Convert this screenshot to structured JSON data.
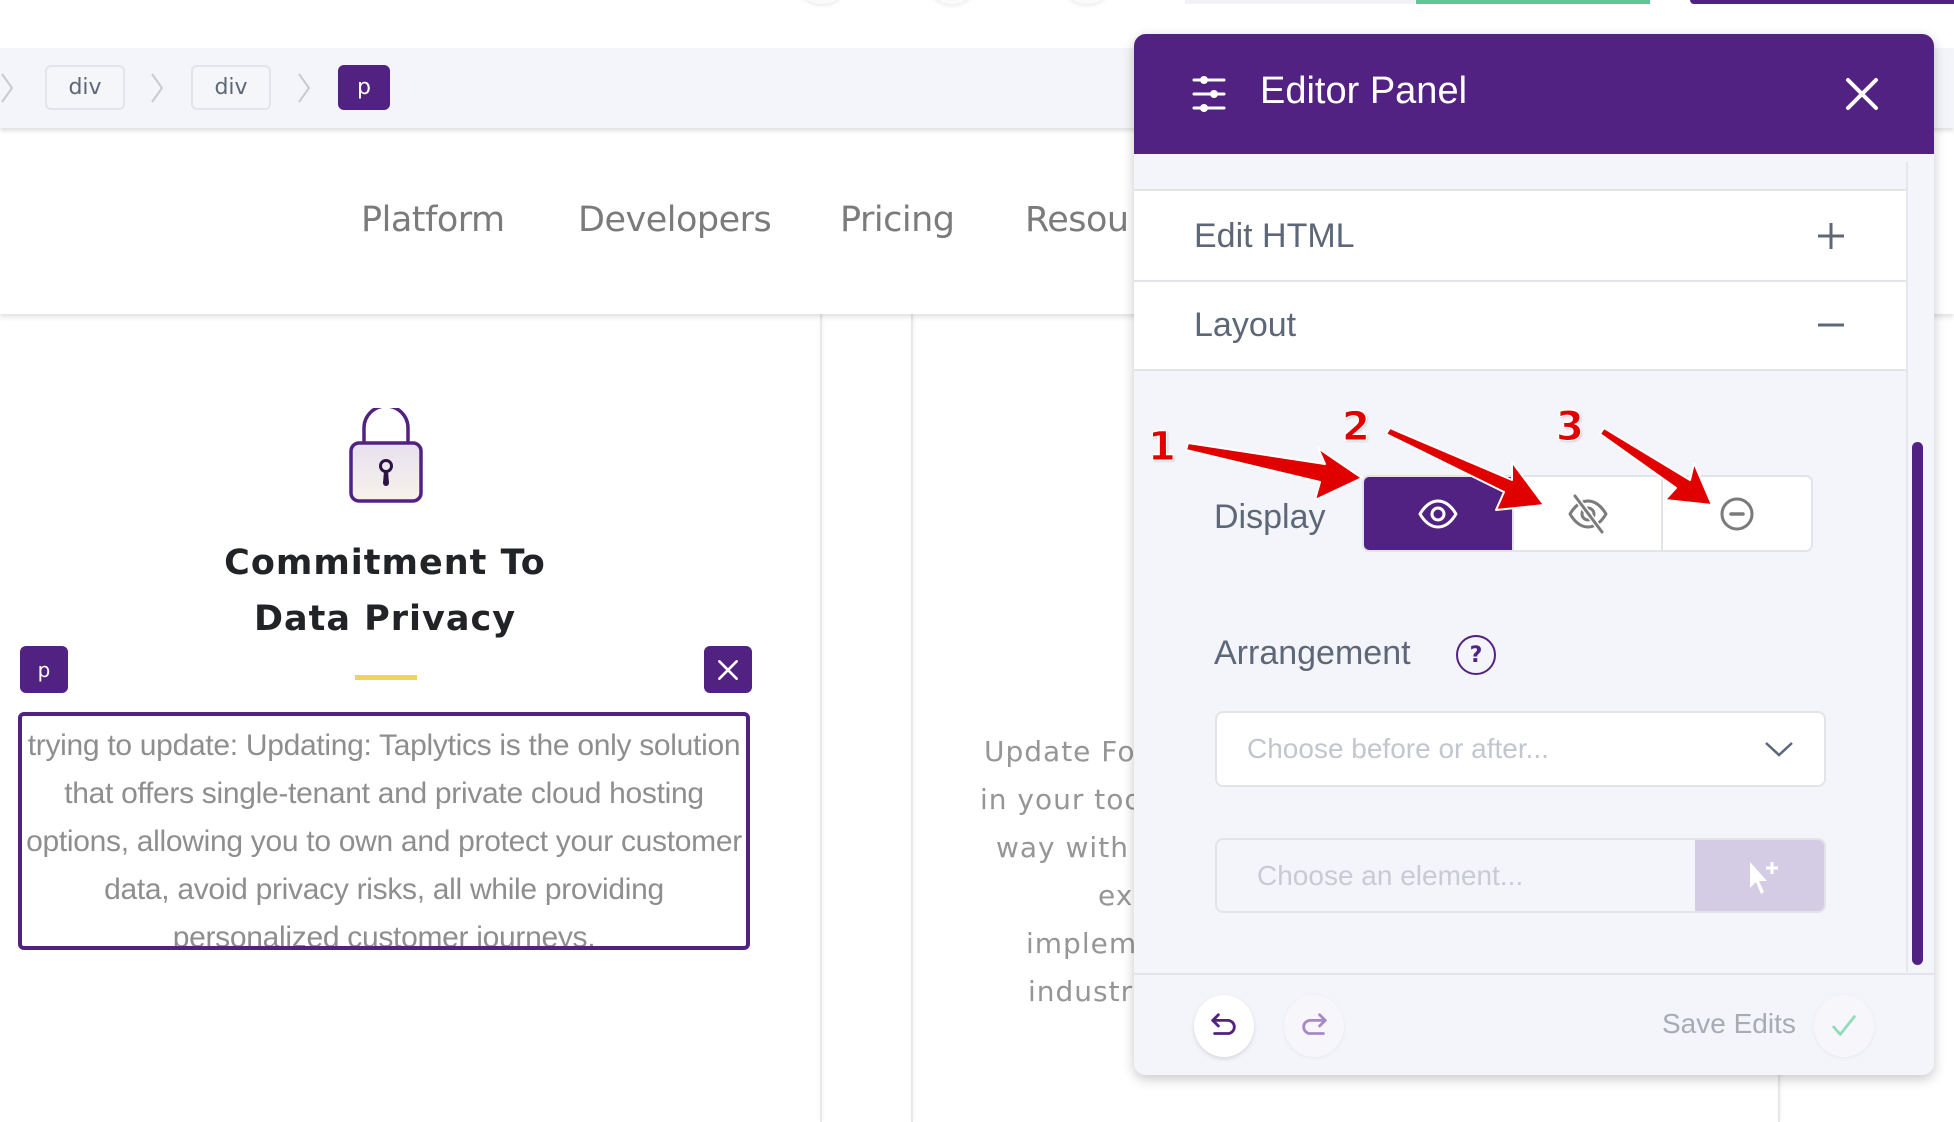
{
  "breadcrumb": {
    "items": [
      "div",
      "div",
      "p"
    ],
    "active_index": 2
  },
  "nav": {
    "links": [
      "Platform",
      "Developers",
      "Pricing",
      "Resou"
    ]
  },
  "card": {
    "icon": "lock-icon",
    "title_line1": "Commitment To",
    "title_line2": "Data Privacy",
    "tag_label": "p",
    "selected_text": "trying to update: Updating: Taplytics is the only solution that offers single-tenant and private cloud hosting options, allowing you to own and protect your customer data, avoid privacy risks, all while providing personalized customer journeys."
  },
  "middle_card": {
    "lines": [
      "Update For",
      "in your too",
      "way with t",
      "expe",
      "impleme",
      "industry"
    ]
  },
  "editor_panel": {
    "title": "Editor Panel",
    "sections": [
      {
        "label": "Edit HTML",
        "state": "collapsed",
        "toggle": "+"
      },
      {
        "label": "Layout",
        "state": "expanded",
        "toggle": "−"
      }
    ],
    "display": {
      "label": "Display",
      "options": [
        {
          "icon": "eye-icon",
          "name": "visible",
          "selected": true
        },
        {
          "icon": "eye-off-icon",
          "name": "hidden",
          "selected": false
        },
        {
          "icon": "minus-circle-icon",
          "name": "remove",
          "selected": false
        }
      ]
    },
    "arrangement": {
      "label": "Arrangement",
      "help": "?",
      "select_placeholder": "Choose before or after...",
      "element_placeholder": "Choose an element..."
    },
    "footer": {
      "save_label": "Save Edits"
    }
  },
  "annotations": [
    "1",
    "2",
    "3"
  ],
  "colors": {
    "brand_purple": "#522283",
    "annotation_red": "#e00000",
    "accent_yellow": "#ecd55a",
    "save_check_green": "#8fdcbc",
    "top_green": "#5ec795"
  }
}
